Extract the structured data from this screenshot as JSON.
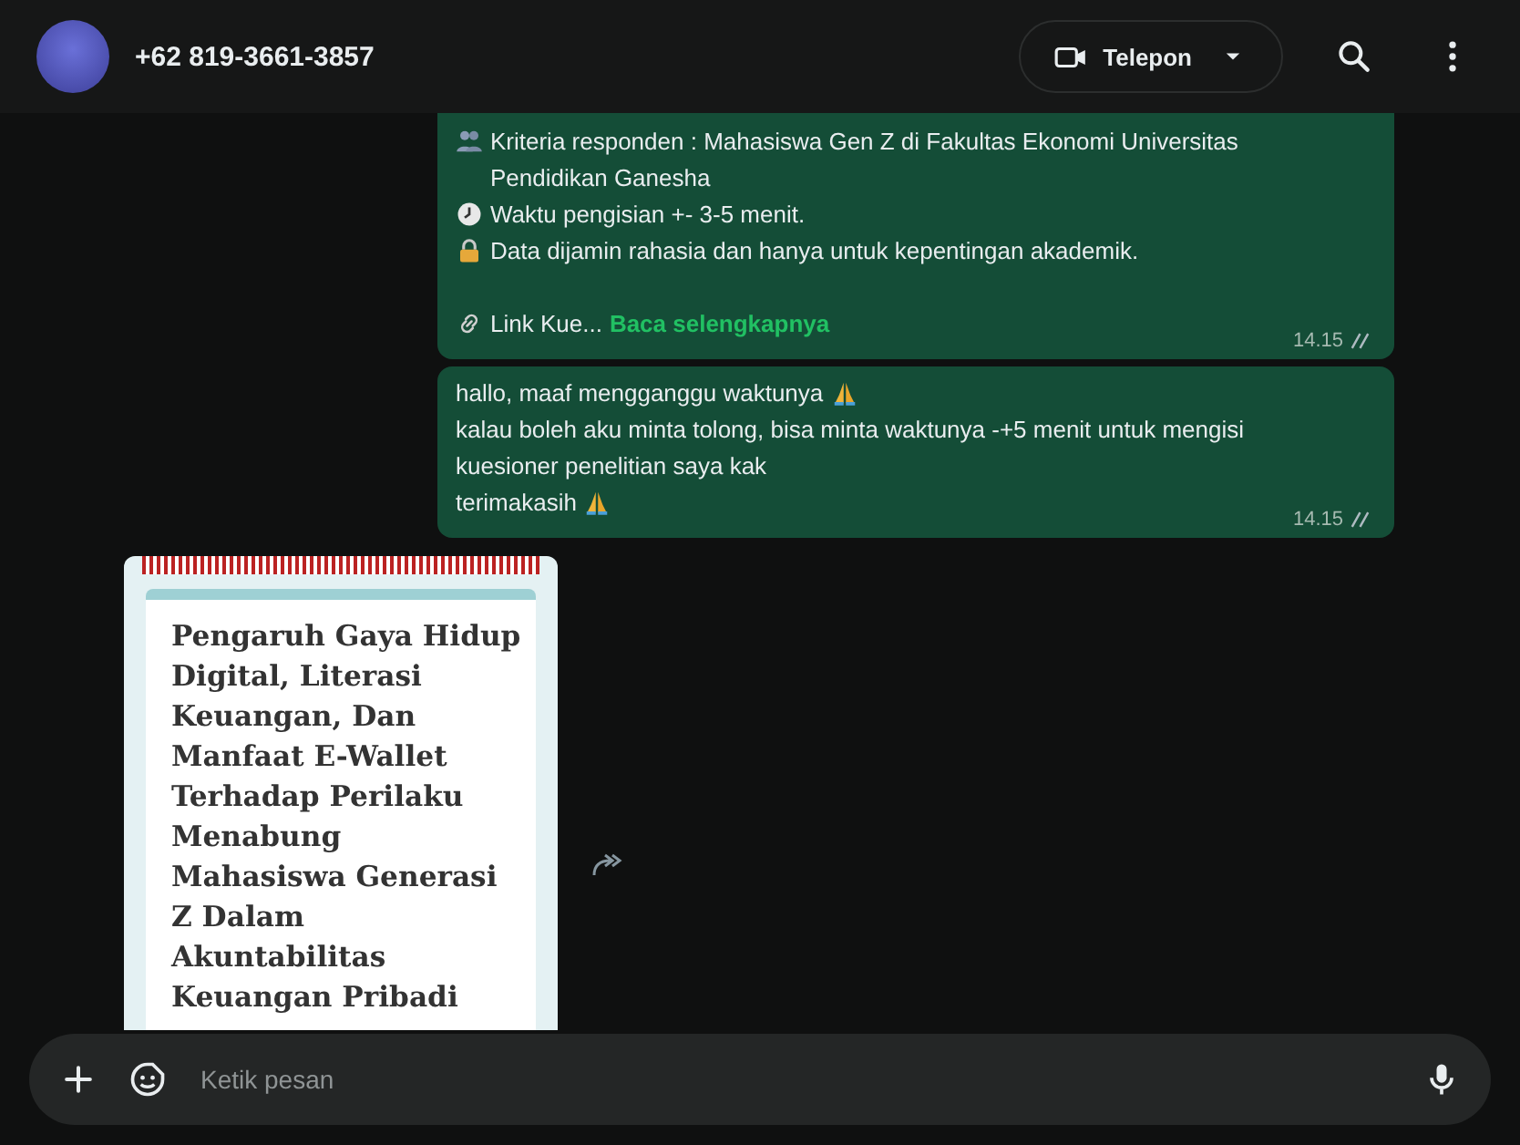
{
  "header": {
    "contact": "+62 819-3661-3857",
    "call_button": "Telepon"
  },
  "messages": [
    {
      "kind": "text",
      "lines": [
        {
          "kind": "people",
          "text": "Kriteria responden : Mahasiswa Gen Z di Fakultas Ekonomi Universitas Pendidikan Ganesha"
        },
        {
          "kind": "clock",
          "text": "Waktu pengisian +- 3-5 menit."
        },
        {
          "kind": "lock",
          "text": "Data dijamin rahasia dan hanya untuk kepentingan akademik."
        },
        {
          "kind": "blank"
        },
        {
          "kind": "link",
          "text": "Link Kue...",
          "more": "Baca selengkapnya"
        }
      ],
      "time": "14.15",
      "read": false
    },
    {
      "kind": "text",
      "lines": [
        {
          "kind": "pray",
          "text": "hallo, maaf mengganggu waktunya"
        },
        {
          "kind": "plain",
          "text": "kalau boleh aku minta tolong, bisa minta waktunya -+5 menit untuk mengisi kuesioner penelitian saya kak"
        },
        {
          "kind": "pray",
          "text": "terimakasih"
        }
      ],
      "time": "14.15",
      "read": false
    },
    {
      "kind": "document",
      "title": "Pengaruh Gaya Hidup Digital, Literasi Keuangan, Dan Manfaat E-Wallet Terhadap Perilaku Menabung Mahasiswa Generasi Z Dalam Akuntabilitas Keuangan Pribadi"
    }
  ],
  "composer": {
    "placeholder": "Ketik pesan"
  }
}
